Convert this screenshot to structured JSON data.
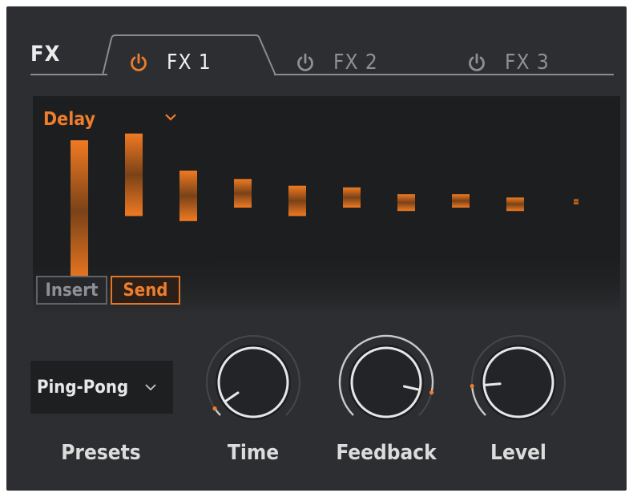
{
  "header": {
    "title": "FX"
  },
  "tabs": [
    {
      "label": "FX 1",
      "active": true,
      "power_icon": "power-icon",
      "power_color": "#ee7d2c"
    },
    {
      "label": "FX 2",
      "active": false,
      "power_icon": "power-icon",
      "power_color": "#8e9095"
    },
    {
      "label": "FX 3",
      "active": false,
      "power_icon": "power-icon",
      "power_color": "#8e9095"
    }
  ],
  "effect": {
    "type": "Delay",
    "type_icon": "chevron-down-icon",
    "routing": {
      "insert_label": "Insert",
      "send_label": "Send",
      "selected": "Send"
    },
    "echo_bars": [
      {
        "top": 0.1,
        "bottom": 0.95
      },
      {
        "top": 0.06,
        "bottom": 0.55
      },
      {
        "top": 0.28,
        "bottom": 0.58
      },
      {
        "top": 0.33,
        "bottom": 0.5
      },
      {
        "top": 0.37,
        "bottom": 0.55
      },
      {
        "top": 0.38,
        "bottom": 0.5
      },
      {
        "top": 0.42,
        "bottom": 0.52
      },
      {
        "top": 0.42,
        "bottom": 0.5
      },
      {
        "top": 0.44,
        "bottom": 0.52
      },
      {
        "top": 0.45,
        "bottom": 0.48
      }
    ]
  },
  "presets": {
    "value": "Ping-Pong",
    "label": "Presets",
    "icon": "chevron-down-icon"
  },
  "knobs": [
    {
      "id": "time",
      "label": "Time",
      "value": 0.04
    },
    {
      "id": "feedback",
      "label": "Feedback",
      "value": 0.88
    },
    {
      "id": "level",
      "label": "Level",
      "value": 0.15
    }
  ],
  "colors": {
    "accent": "#ee7d2c",
    "panel": "#2c2e31",
    "display": "#1d1e20",
    "text": "#e8e8e8",
    "dim": "#8e9095"
  }
}
